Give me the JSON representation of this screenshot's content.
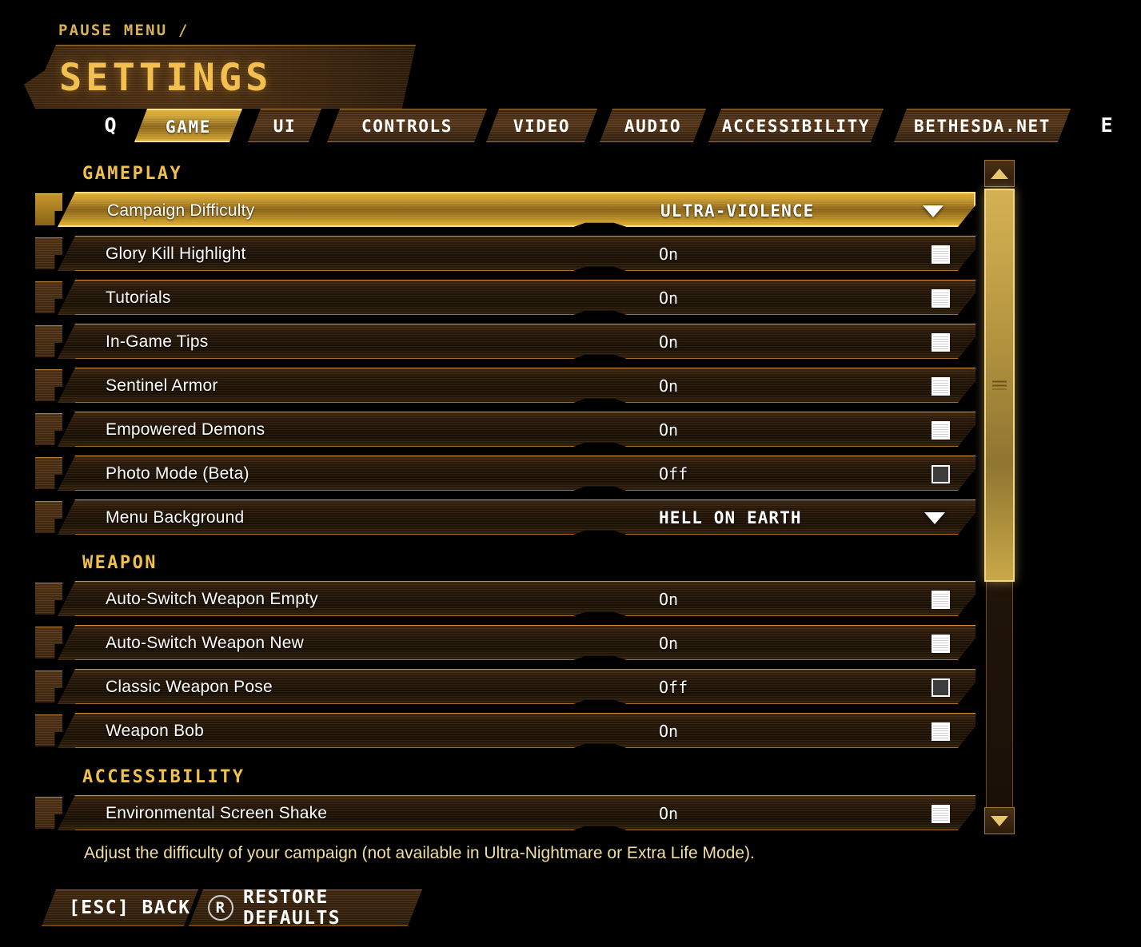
{
  "header": {
    "breadcrumb": "PAUSE MENU /",
    "title": "SETTINGS"
  },
  "tabs": {
    "prev_key": "Q",
    "next_key": "E",
    "items": [
      {
        "label": "GAME",
        "selected": true
      },
      {
        "label": "UI",
        "selected": false
      },
      {
        "label": "CONTROLS",
        "selected": false
      },
      {
        "label": "VIDEO",
        "selected": false
      },
      {
        "label": "AUDIO",
        "selected": false
      },
      {
        "label": "ACCESSIBILITY",
        "selected": false
      },
      {
        "label": "BETHESDA.NET",
        "selected": false
      }
    ]
  },
  "sections": [
    {
      "heading": "GAMEPLAY",
      "rows": [
        {
          "label": "Campaign Difficulty",
          "value": "ULTRA-VIOLENCE",
          "control": "dropdown",
          "selected": true
        },
        {
          "label": "Glory Kill Highlight",
          "value": "On",
          "control": "checkbox",
          "checked": true
        },
        {
          "label": "Tutorials",
          "value": "On",
          "control": "checkbox",
          "checked": true
        },
        {
          "label": "In-Game Tips",
          "value": "On",
          "control": "checkbox",
          "checked": true
        },
        {
          "label": "Sentinel Armor",
          "value": "On",
          "control": "checkbox",
          "checked": true
        },
        {
          "label": "Empowered Demons",
          "value": "On",
          "control": "checkbox",
          "checked": true
        },
        {
          "label": "Photo Mode (Beta)",
          "value": "Off",
          "control": "checkbox",
          "checked": false
        },
        {
          "label": "Menu Background",
          "value": "HELL ON EARTH",
          "control": "dropdown",
          "selected": false
        }
      ]
    },
    {
      "heading": "WEAPON",
      "rows": [
        {
          "label": "Auto-Switch Weapon Empty",
          "value": "On",
          "control": "checkbox",
          "checked": true
        },
        {
          "label": "Auto-Switch Weapon New",
          "value": "On",
          "control": "checkbox",
          "checked": true
        },
        {
          "label": "Classic Weapon Pose",
          "value": "Off",
          "control": "checkbox",
          "checked": false
        },
        {
          "label": "Weapon Bob",
          "value": "On",
          "control": "checkbox",
          "checked": true
        }
      ]
    },
    {
      "heading": "ACCESSIBILITY",
      "rows": [
        {
          "label": "Environmental Screen Shake",
          "value": "On",
          "control": "checkbox",
          "checked": true
        }
      ]
    }
  ],
  "help_text": "Adjust the difficulty of your campaign (not available in Ultra-Nightmare or Extra Life Mode).",
  "footer": {
    "back_label": "[ESC] BACK",
    "restore_key": "R",
    "restore_label": "RESTORE DEFAULTS"
  },
  "colors": {
    "accent_gold": "#f0c04e",
    "accent_bronze": "#e0983e",
    "row_dark": "#24160a",
    "text_white": "#ffffff",
    "help_text": "#f2dfa0"
  }
}
